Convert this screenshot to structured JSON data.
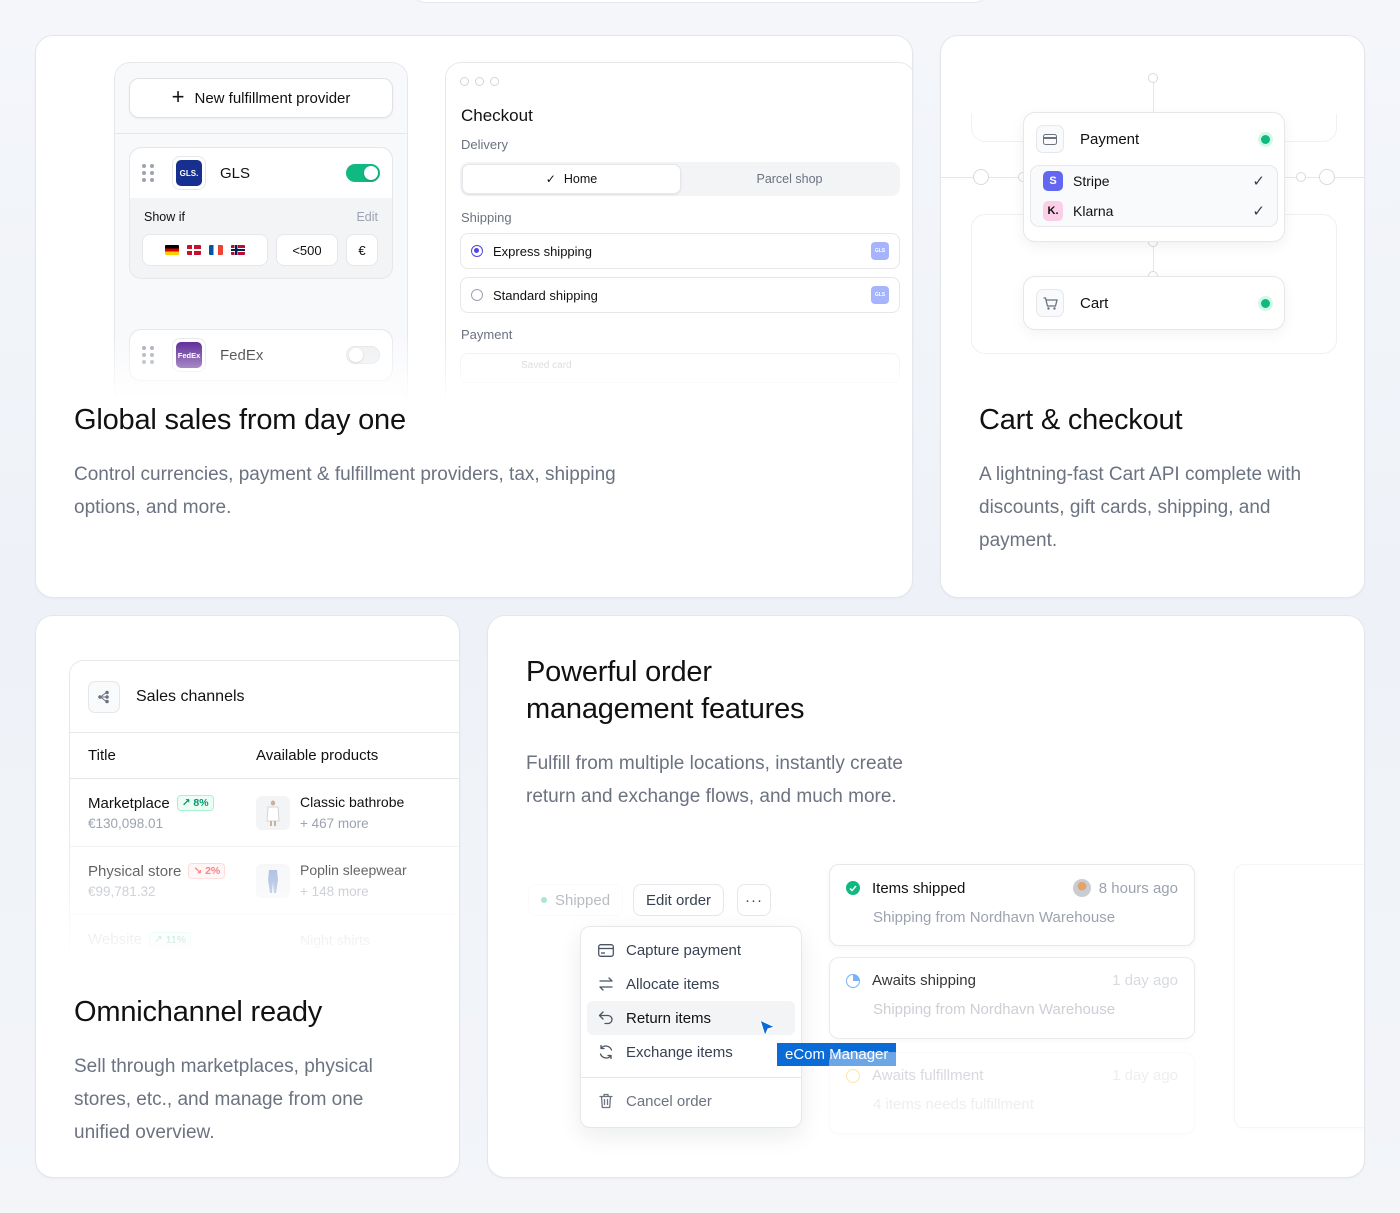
{
  "global_sales": {
    "title": "Global sales from day one",
    "desc": "Control currencies, payment & fulfillment providers, tax, shipping options, and more.",
    "new_provider_label": "New fulfillment provider",
    "providers": [
      {
        "name": "GLS",
        "logo": "GLS.",
        "enabled": true
      },
      {
        "name": "FedEx",
        "logo": "FedEx",
        "enabled": false
      }
    ],
    "show_if_label": "Show if",
    "edit_label": "Edit",
    "condition_amount": "<500",
    "condition_currency": "€",
    "checkout": {
      "title": "Checkout",
      "delivery_label": "Delivery",
      "delivery_options": [
        "Home",
        "Parcel shop"
      ],
      "shipping_label": "Shipping",
      "shipping_options": [
        "Express shipping",
        "Standard shipping"
      ],
      "payment_label": "Payment",
      "saved_card_label": "Saved card"
    }
  },
  "cart_checkout": {
    "title": "Cart & checkout",
    "desc": "A lightning-fast Cart API complete with discounts, gift cards, shipping, and payment.",
    "payment_label": "Payment",
    "methods": [
      {
        "name": "Stripe",
        "logo": "S",
        "color": "#6366f1"
      },
      {
        "name": "Klarna",
        "logo": "K.",
        "color": "#fbcfe8"
      }
    ],
    "cart_label": "Cart"
  },
  "omnichannel": {
    "title": "Omnichannel ready",
    "desc": "Sell through marketplaces, physical stores, etc., and manage from one unified overview.",
    "panel_title": "Sales channels",
    "col_title": "Title",
    "col_products": "Available products",
    "rows": [
      {
        "name": "Marketplace",
        "change": "8%",
        "trend": "up",
        "revenue": "€130,098.01",
        "product": "Classic bathrobe",
        "more": "+ 467 more"
      },
      {
        "name": "Physical store",
        "change": "2%",
        "trend": "down",
        "revenue": "€99,781.32",
        "product": "Poplin sleepwear",
        "more": "+ 148 more"
      },
      {
        "name": "Website",
        "change": "11%",
        "trend": "up",
        "revenue": "",
        "product": "Night shirts",
        "more": ""
      }
    ]
  },
  "orders": {
    "title_line1": "Powerful order",
    "title_line2": "management features",
    "desc": "Fulfill from multiple locations, instantly create return and exchange flows, and much more.",
    "status_label": "Shipped",
    "edit_order_label": "Edit order",
    "more_label": "···",
    "menu": [
      "Capture payment",
      "Allocate items",
      "Return items",
      "Exchange items"
    ],
    "cancel_label": "Cancel order",
    "cursor_tag": "eCom Manager",
    "timeline": [
      {
        "title": "Items shipped",
        "time": "8 hours ago",
        "sub": "Shipping from Nordhavn Warehouse",
        "status": "done"
      },
      {
        "title": "Awaits shipping",
        "time": "1 day ago",
        "sub": "Shipping from Nordhavn Warehouse",
        "status": "pending"
      },
      {
        "title": "Awaits fulfillment",
        "time": "1 day ago",
        "sub": "4 items needs fulfillment",
        "status": "waiting"
      }
    ]
  }
}
